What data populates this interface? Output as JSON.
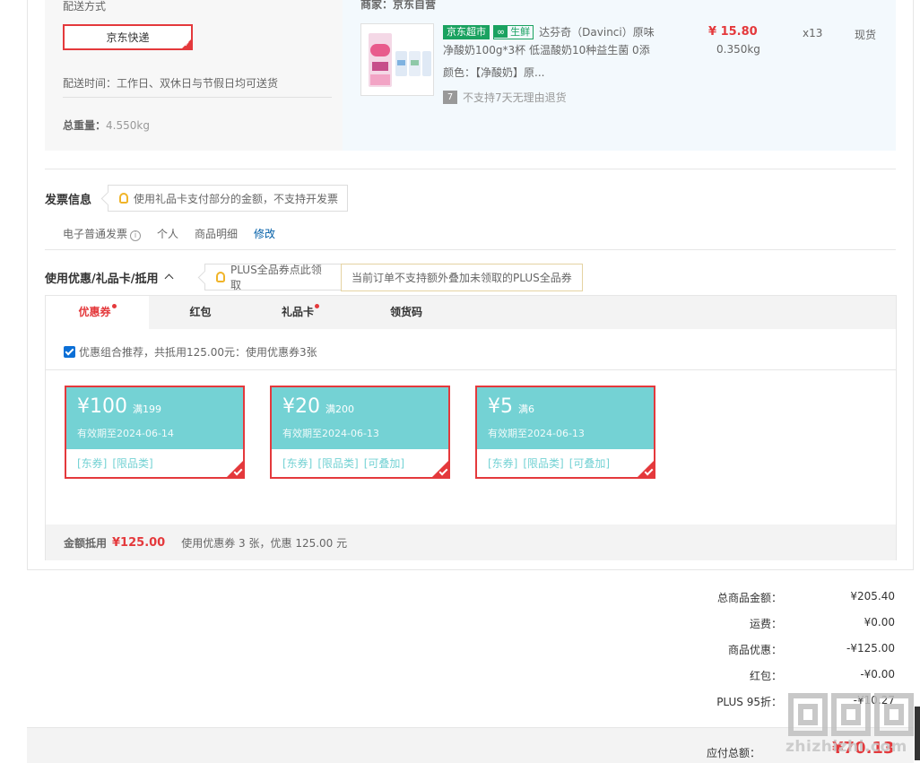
{
  "shipping": {
    "title": "配送方式",
    "method": "京东快递",
    "time": "配送时间：工作日、双休日与节假日均可送货",
    "weight_label": "总重量：",
    "weight_value": "4.550kg"
  },
  "product": {
    "seller": "商家：京东自营",
    "tag_market": "京东超市",
    "tag_fresh": "生鲜",
    "name": "达芬奇（Davinci）原味净酸奶100g*3杯 低温酸奶10种益生菌 0添",
    "color": "颜色：【净酸奶】原...",
    "return_icon": "7",
    "return_text": "不支持7天无理由退货",
    "price": "¥ 15.80",
    "weight": "0.350kg",
    "qty": "x13",
    "stock": "现货"
  },
  "invoice": {
    "title": "发票信息",
    "tip": "使用礼品卡支付部分的金额，不支持开发票",
    "type": "电子普通发票",
    "info_icon": "i",
    "person": "个人",
    "detail": "商品明细",
    "edit": "修改"
  },
  "coupons": {
    "title": "使用优惠/礼品卡/抵用",
    "plus_tip": "PLUS全品券点此领取",
    "plus_note": "当前订单不支持额外叠加未领取的PLUS全品券",
    "tabs": [
      {
        "label": "优惠券"
      },
      {
        "label": "红包"
      },
      {
        "label": "礼品卡"
      },
      {
        "label": "领货码"
      }
    ],
    "recommend": "优惠组合推荐，共抵用125.00元：使用优惠券3张",
    "items": [
      {
        "amount": "¥100",
        "cond": "满199",
        "expire": "有效期至2024-06-14",
        "tags": [
          "[东券]",
          "[限品类]"
        ]
      },
      {
        "amount": "¥20",
        "cond": "满200",
        "expire": "有效期至2024-06-13",
        "tags": [
          "[东券]",
          "[限品类]",
          "[可叠加]"
        ]
      },
      {
        "amount": "¥5",
        "cond": "满6",
        "expire": "有效期至2024-06-13",
        "tags": [
          "[东券]",
          "[限品类]",
          "[可叠加]"
        ]
      }
    ],
    "footer_label": "金额抵用",
    "footer_amount": "¥125.00",
    "footer_text": "使用优惠券 3 张，优惠 125.00 元"
  },
  "totals": {
    "rows": [
      {
        "label": "总商品金额：",
        "value": "¥205.40"
      },
      {
        "label": "运费：",
        "value": "¥0.00"
      },
      {
        "label": "商品优惠：",
        "value": "-¥125.00"
      },
      {
        "label": "红包：",
        "value": "-¥0.00"
      },
      {
        "label": "PLUS 95折：",
        "value": "-¥10.27"
      }
    ],
    "pay_label": "应付总额：",
    "pay_value": "¥70.13"
  },
  "watermark": {
    "text": "zhizhizhi.com"
  },
  "colors": {
    "accent": "#e4393c",
    "coupon": "#74d2d4",
    "fresh": "#1aa260",
    "link": "#005ea7"
  }
}
